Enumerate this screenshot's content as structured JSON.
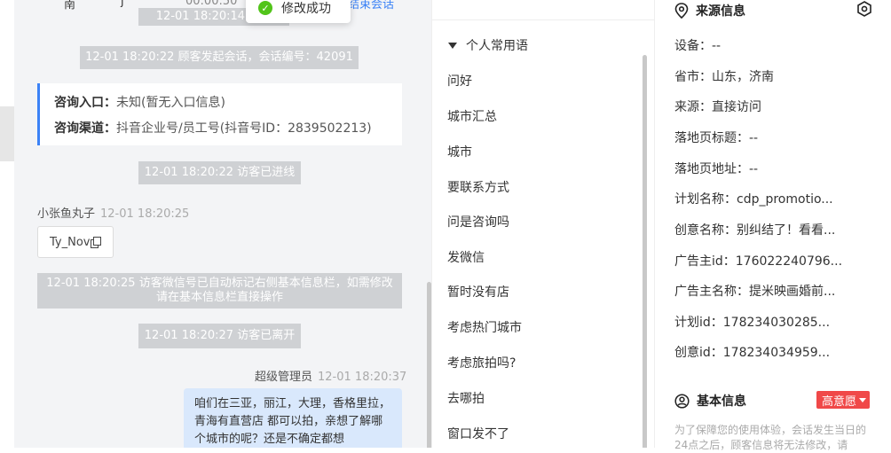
{
  "toast": {
    "text": "修改成功"
  },
  "chat_top": {
    "name_frag": "南",
    "name_frag2": "j",
    "timer": "00:00:50",
    "end_link": "结束会话",
    "faded_msg": "12-01 18:20:14 访客"
  },
  "system_messages": [
    "12-01 18:20:22 顾客发起会话，会话编号：42091",
    "12-01 18:20:22 访客已进线",
    "12-01 18:20:25 访客微信号已自动标记右侧基本信息栏，如需修改请在基本信息栏直接操作",
    "12-01 18:20:27 访客已离开"
  ],
  "consult": {
    "entry_label": "咨询入口：",
    "entry_value": "未知(暂无入口信息)",
    "channel_label": "咨询渠道：",
    "channel_value": "抖音企业号/员工号(抖音号ID：2839502213)"
  },
  "visitor_msg": {
    "sender": "小张鱼丸子",
    "time": "12-01 18:20:25",
    "text": "Ty_Nov"
  },
  "agent_msg": {
    "sender": "超级管理员",
    "time": "12-01 18:20:37",
    "text": "咱们在三亚，丽江，大理，香格里拉，青海有直营店 都可以拍，亲想了解哪个城市的呢？还是不确定都想"
  },
  "phrases": {
    "group_title": "个人常用语",
    "items": [
      "问好",
      "城市汇总",
      "城市",
      "要联系方式",
      "问是咨询吗",
      "发微信",
      "暂时没有店",
      "考虑热门城市",
      "考虑旅拍吗?",
      "去哪拍",
      "窗口发不了"
    ]
  },
  "source_info": {
    "title": "来源信息",
    "fields": [
      "设备：--",
      "省市：山东，济南",
      "来源：直接访问",
      "落地页标题：--",
      "落地页地址：--",
      "计划名称：cdp_promotio...",
      "创意名称：别纠结了！看看...",
      "广告主id：176022240796...",
      "广告主名称：提米映画婚前...",
      "计划id：178234030285...",
      "创意id：178234034959..."
    ]
  },
  "basic_info": {
    "title": "基本信息",
    "badge": "高意愿",
    "notice": "为了保障您的使用体验，会话发生当日的24点之后，顾客信息将无法修改，请"
  },
  "colors": {
    "accent": "#3b82f6",
    "success": "#52c41a",
    "badge": "#f04848",
    "bubble": "#d9e8fc"
  }
}
